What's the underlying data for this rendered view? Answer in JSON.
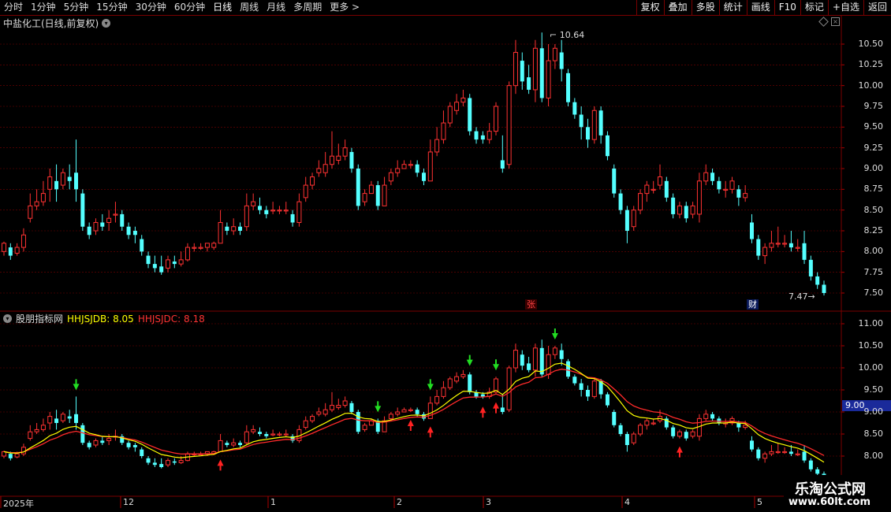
{
  "toolbar": {
    "periods": [
      "分时",
      "1分钟",
      "5分钟",
      "15分钟",
      "30分钟",
      "60分钟",
      "日线",
      "周线",
      "月线",
      "多周期",
      "更多 >"
    ],
    "active_period": "日线",
    "actions": [
      "复权",
      "叠加",
      "多股",
      "统计",
      "画线",
      "F10",
      "标记",
      "+自选",
      "返回"
    ]
  },
  "main_chart": {
    "title": "中盐化工(日线,前复权)",
    "high_label": "10.64",
    "low_label": "7.47",
    "badge_zhang": "张",
    "badge_cai": "财"
  },
  "indicator": {
    "name": "股朋指标网",
    "line1_label": "HHJSJDB: 8.05",
    "line2_label": "HHJSJDC: 8.18",
    "price_tag": "9.00"
  },
  "axes": {
    "main_ticks": [
      "10.50",
      "10.25",
      "10.00",
      "9.75",
      "9.50",
      "9.25",
      "9.00",
      "8.75",
      "8.50",
      "8.25",
      "8.00",
      "7.75",
      "7.50"
    ],
    "ind_ticks": [
      "11.00",
      "10.50",
      "10.00",
      "9.50",
      "9.00",
      "8.50",
      "8.00"
    ],
    "time_labels": [
      "2025年",
      "12",
      "1",
      "2",
      "3",
      "4",
      "5"
    ]
  },
  "watermark": {
    "line1": "乐淘公式网",
    "line2": "www.60lt.com"
  },
  "colors": {
    "up": "#ff3232",
    "down": "#54ffff",
    "grid": "#7a0000",
    "yellow": "#ffff00",
    "red_line": "#ff2a2a"
  },
  "chart_data": {
    "type": "candlestick",
    "candles": [
      [
        8.0,
        8.1,
        7.95,
        8.12
      ],
      [
        8.05,
        7.95,
        7.9,
        8.1
      ],
      [
        7.98,
        8.05,
        7.95,
        8.1
      ],
      [
        8.05,
        8.2,
        8.0,
        8.28
      ],
      [
        8.4,
        8.55,
        8.35,
        8.7
      ],
      [
        8.55,
        8.6,
        8.5,
        8.75
      ],
      [
        8.6,
        8.7,
        8.55,
        8.85
      ],
      [
        8.75,
        8.9,
        8.6,
        9.0
      ],
      [
        8.85,
        8.75,
        8.6,
        9.05
      ],
      [
        8.8,
        8.95,
        8.75,
        9.0
      ],
      [
        8.9,
        8.85,
        8.75,
        9.05
      ],
      [
        8.95,
        8.75,
        8.6,
        9.35
      ],
      [
        8.7,
        8.3,
        8.25,
        8.75
      ],
      [
        8.3,
        8.2,
        8.15,
        8.35
      ],
      [
        8.25,
        8.35,
        8.2,
        8.4
      ],
      [
        8.35,
        8.3,
        8.25,
        8.45
      ],
      [
        8.35,
        8.4,
        8.25,
        8.5
      ],
      [
        8.45,
        8.45,
        8.35,
        8.6
      ],
      [
        8.45,
        8.3,
        8.25,
        8.5
      ],
      [
        8.3,
        8.2,
        8.15,
        8.35
      ],
      [
        8.25,
        8.2,
        8.1,
        8.3
      ],
      [
        8.15,
        8.0,
        7.95,
        8.2
      ],
      [
        7.95,
        7.85,
        7.8,
        8.0
      ],
      [
        7.85,
        7.8,
        7.75,
        7.95
      ],
      [
        7.82,
        7.75,
        7.72,
        7.95
      ],
      [
        7.8,
        7.9,
        7.75,
        7.95
      ],
      [
        7.88,
        7.85,
        7.8,
        7.95
      ],
      [
        7.85,
        7.9,
        7.82,
        8.0
      ],
      [
        7.9,
        8.05,
        7.88,
        8.1
      ],
      [
        8.05,
        8.05,
        8.0,
        8.1
      ],
      [
        8.05,
        8.05,
        8.02,
        8.1
      ],
      [
        8.05,
        8.1,
        8.0,
        8.1
      ],
      [
        8.05,
        8.1,
        8.02,
        8.12
      ],
      [
        8.1,
        8.35,
        8.1,
        8.5
      ],
      [
        8.3,
        8.25,
        8.2,
        8.35
      ],
      [
        8.25,
        8.3,
        8.2,
        8.4
      ],
      [
        8.3,
        8.25,
        8.2,
        8.35
      ],
      [
        8.3,
        8.55,
        8.25,
        8.7
      ],
      [
        8.55,
        8.6,
        8.5,
        8.7
      ],
      [
        8.55,
        8.5,
        8.45,
        8.65
      ],
      [
        8.5,
        8.45,
        8.4,
        8.55
      ],
      [
        8.5,
        8.5,
        8.45,
        8.6
      ],
      [
        8.5,
        8.5,
        8.45,
        8.55
      ],
      [
        8.5,
        8.5,
        8.45,
        8.6
      ],
      [
        8.45,
        8.35,
        8.3,
        8.5
      ],
      [
        8.35,
        8.6,
        8.3,
        8.7
      ],
      [
        8.65,
        8.8,
        8.6,
        8.9
      ],
      [
        8.8,
        8.9,
        8.75,
        8.95
      ],
      [
        8.95,
        9.0,
        8.9,
        9.1
      ],
      [
        8.95,
        9.05,
        8.9,
        9.2
      ],
      [
        9.05,
        9.15,
        9.0,
        9.45
      ],
      [
        9.1,
        9.15,
        9.05,
        9.3
      ],
      [
        9.15,
        9.25,
        9.1,
        9.35
      ],
      [
        9.2,
        9.0,
        8.95,
        9.25
      ],
      [
        9.0,
        8.55,
        8.5,
        9.05
      ],
      [
        8.6,
        8.7,
        8.55,
        8.75
      ],
      [
        8.7,
        8.8,
        8.7,
        8.85
      ],
      [
        8.8,
        8.55,
        8.5,
        8.85
      ],
      [
        8.55,
        8.8,
        8.55,
        8.9
      ],
      [
        8.85,
        8.95,
        8.8,
        9.0
      ],
      [
        8.95,
        9.0,
        8.9,
        9.1
      ],
      [
        9.0,
        9.05,
        9.0,
        9.1
      ],
      [
        9.05,
        9.05,
        9.0,
        9.1
      ],
      [
        9.05,
        8.95,
        8.9,
        9.1
      ],
      [
        8.95,
        8.85,
        8.8,
        9.0
      ],
      [
        8.85,
        9.2,
        8.85,
        9.35
      ],
      [
        9.2,
        9.35,
        9.15,
        9.5
      ],
      [
        9.35,
        9.55,
        9.3,
        9.7
      ],
      [
        9.55,
        9.75,
        9.5,
        9.8
      ],
      [
        9.7,
        9.8,
        9.65,
        9.9
      ],
      [
        9.8,
        9.85,
        9.75,
        9.95
      ],
      [
        9.85,
        9.45,
        9.4,
        9.9
      ],
      [
        9.45,
        9.35,
        9.3,
        9.5
      ],
      [
        9.4,
        9.35,
        9.3,
        9.45
      ],
      [
        9.35,
        9.45,
        9.3,
        9.55
      ],
      [
        9.45,
        9.75,
        9.4,
        9.8
      ],
      [
        9.1,
        9.0,
        8.95,
        9.4
      ],
      [
        9.05,
        10.0,
        9.0,
        10.05
      ],
      [
        10.0,
        10.4,
        9.9,
        10.55
      ],
      [
        10.3,
        10.05,
        9.95,
        10.4
      ],
      [
        10.1,
        9.95,
        9.9,
        10.25
      ],
      [
        9.95,
        10.45,
        9.8,
        10.55
      ],
      [
        10.45,
        9.85,
        9.8,
        10.64
      ],
      [
        9.85,
        10.3,
        9.75,
        10.5
      ],
      [
        10.3,
        10.45,
        10.2,
        10.5
      ],
      [
        10.4,
        10.2,
        10.05,
        10.55
      ],
      [
        10.15,
        9.8,
        9.75,
        10.2
      ],
      [
        9.8,
        9.65,
        9.6,
        9.85
      ],
      [
        9.65,
        9.5,
        9.35,
        9.75
      ],
      [
        9.5,
        9.35,
        9.25,
        9.6
      ],
      [
        9.35,
        9.7,
        9.3,
        9.75
      ],
      [
        9.7,
        9.4,
        9.3,
        9.75
      ],
      [
        9.4,
        9.15,
        9.1,
        9.45
      ],
      [
        9.0,
        8.7,
        8.65,
        9.05
      ],
      [
        8.7,
        8.5,
        8.45,
        8.75
      ],
      [
        8.5,
        8.25,
        8.1,
        8.55
      ],
      [
        8.3,
        8.5,
        8.25,
        8.55
      ],
      [
        8.5,
        8.7,
        8.45,
        8.75
      ],
      [
        8.7,
        8.8,
        8.6,
        8.85
      ],
      [
        8.75,
        8.75,
        8.7,
        8.85
      ],
      [
        8.8,
        8.9,
        8.75,
        9.05
      ],
      [
        8.85,
        8.65,
        8.6,
        8.9
      ],
      [
        8.65,
        8.45,
        8.4,
        8.7
      ],
      [
        8.45,
        8.55,
        8.4,
        8.6
      ],
      [
        8.55,
        8.4,
        8.35,
        8.6
      ],
      [
        8.45,
        8.55,
        8.4,
        8.6
      ],
      [
        8.45,
        8.85,
        8.35,
        8.95
      ],
      [
        8.85,
        8.95,
        8.8,
        9.05
      ],
      [
        8.95,
        8.85,
        8.8,
        9.0
      ],
      [
        8.85,
        8.75,
        8.7,
        8.9
      ],
      [
        8.75,
        8.75,
        8.65,
        8.85
      ],
      [
        8.75,
        8.85,
        8.7,
        8.9
      ],
      [
        8.75,
        8.65,
        8.55,
        8.8
      ],
      [
        8.65,
        8.7,
        8.6,
        8.8
      ],
      [
        8.35,
        8.15,
        8.1,
        8.45
      ],
      [
        8.15,
        7.95,
        7.9,
        8.2
      ],
      [
        7.95,
        8.05,
        7.85,
        8.1
      ],
      [
        8.05,
        8.1,
        8.0,
        8.25
      ],
      [
        8.1,
        8.1,
        8.05,
        8.3
      ],
      [
        8.1,
        8.1,
        8.05,
        8.2
      ],
      [
        8.1,
        8.05,
        8.0,
        8.25
      ],
      [
        8.05,
        8.05,
        8.0,
        8.15
      ],
      [
        8.1,
        7.9,
        7.85,
        8.25
      ],
      [
        7.9,
        7.7,
        7.65,
        7.95
      ],
      [
        7.7,
        7.6,
        7.55,
        7.75
      ],
      [
        7.6,
        7.5,
        7.47,
        7.65
      ]
    ]
  }
}
